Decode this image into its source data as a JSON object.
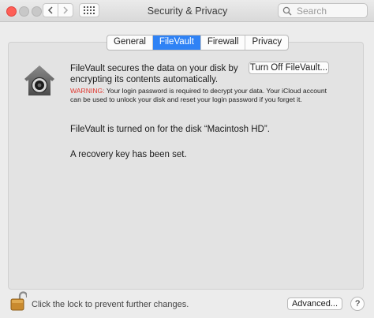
{
  "window": {
    "title": "Security & Privacy",
    "search_placeholder": "Search"
  },
  "tabs": [
    {
      "label": "General",
      "active": false
    },
    {
      "label": "FileVault",
      "active": true
    },
    {
      "label": "Firewall",
      "active": false
    },
    {
      "label": "Privacy",
      "active": false
    }
  ],
  "filevault": {
    "description": "FileVault secures the data on your disk by encrypting its contents automatically.",
    "turn_off_button": "Turn Off FileVault...",
    "warning_label": "WARNING:",
    "warning_text": " Your login password is required to decrypt your data. Your iCloud account can be used to unlock your disk and reset your login password if you forget it.",
    "status_disk": "FileVault is turned on for the disk “Macintosh HD”.",
    "status_recovery": "A recovery key has been set."
  },
  "footer": {
    "lock_text": "Click the lock to prevent further changes.",
    "advanced_button": "Advanced...",
    "help_button": "?"
  },
  "colors": {
    "accent": "#2f82f5",
    "warning": "#e0372f",
    "close": "#fe5f57"
  }
}
